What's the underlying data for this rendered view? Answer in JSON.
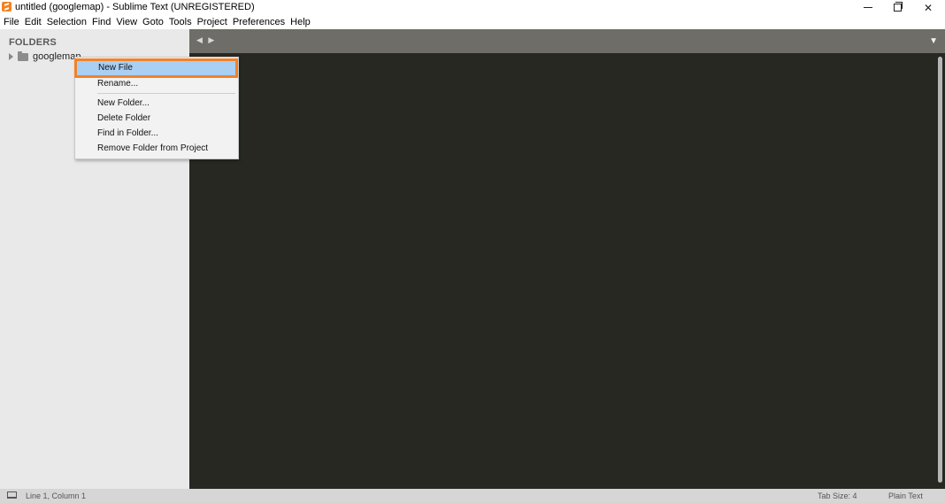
{
  "window": {
    "title": "untitled (googlemap) - Sublime Text (UNREGISTERED)",
    "close_glyph": "✕"
  },
  "menubar": [
    "File",
    "Edit",
    "Selection",
    "Find",
    "View",
    "Goto",
    "Tools",
    "Project",
    "Preferences",
    "Help"
  ],
  "sidebar": {
    "heading": "FOLDERS",
    "folder": "googlemap"
  },
  "tabbar": {
    "nav_glyph": "◀ ▶",
    "dropdown_glyph": "▼"
  },
  "context_menu": {
    "items": [
      "New File",
      "Rename...",
      "New Folder...",
      "Delete Folder",
      "Find in Folder...",
      "Remove Folder from Project"
    ],
    "selected": "New File"
  },
  "statusbar": {
    "position": "Line 1, Column 1",
    "tab_size": "Tab Size: 4",
    "syntax": "Plain Text"
  },
  "colors": {
    "editor_bg": "#272822",
    "sidebar_bg": "#e9e9ea",
    "selection_bg": "#a9cff2",
    "highlight_outline": "#f0832a"
  }
}
